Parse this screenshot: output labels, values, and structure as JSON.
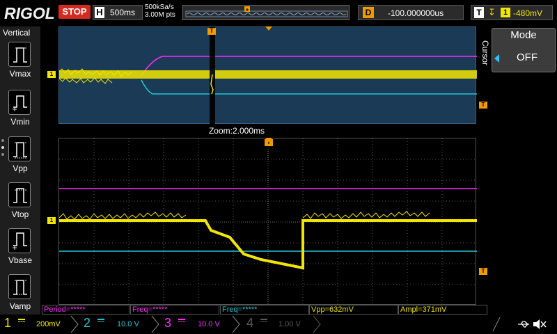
{
  "topbar": {
    "brand": "RIGOL",
    "run_state": "STOP",
    "horizontal_key": "H",
    "timebase": "500ms",
    "sample_rate": "500kSa/s",
    "memory_depth": "3.00M pts",
    "delay_key": "D",
    "delay_value": "-100.000000us",
    "trigger_key": "T",
    "trigger_channel": "1",
    "trigger_level": "-480mV"
  },
  "left_panel": {
    "title": "Vertical",
    "items": [
      {
        "label": "Vmax",
        "icon": "vmax-icon"
      },
      {
        "label": "Vmin",
        "icon": "vmin-icon"
      },
      {
        "label": "Vpp",
        "icon": "vpp-icon"
      },
      {
        "label": "Vtop",
        "icon": "vtop-icon"
      },
      {
        "label": "Vbase",
        "icon": "vbase-icon"
      },
      {
        "label": "Vamp",
        "icon": "vamp-icon"
      }
    ]
  },
  "right_panel": {
    "menu_title": "Cursor",
    "mode_label": "Mode",
    "mode_value": "OFF"
  },
  "zoom": {
    "label": "Zoom:2.000ms"
  },
  "markers": {
    "ch1": "1",
    "trig": "T"
  },
  "measurements": [
    {
      "text": "Period=*****"
    },
    {
      "text": "Freq=*****"
    },
    {
      "text": "Freq=*****"
    },
    {
      "text": "Vpp=632mV"
    },
    {
      "text": "Ampl=371mV"
    }
  ],
  "channels": [
    {
      "num": "1",
      "scale": "200mV",
      "color": "#f2e600"
    },
    {
      "num": "2",
      "scale": "10.0 V",
      "color": "#20c8d8"
    },
    {
      "num": "3",
      "scale": "10.0 V",
      "color": "#ff2bff"
    },
    {
      "num": "4",
      "scale": "1.00 V",
      "color": "#5a5a5a"
    }
  ],
  "colors": {
    "ch1": "#f2e600",
    "ch2": "#20c8d8",
    "ch3": "#ff2bff",
    "trigger": "#f09a00",
    "stop": "#d42a1f"
  }
}
